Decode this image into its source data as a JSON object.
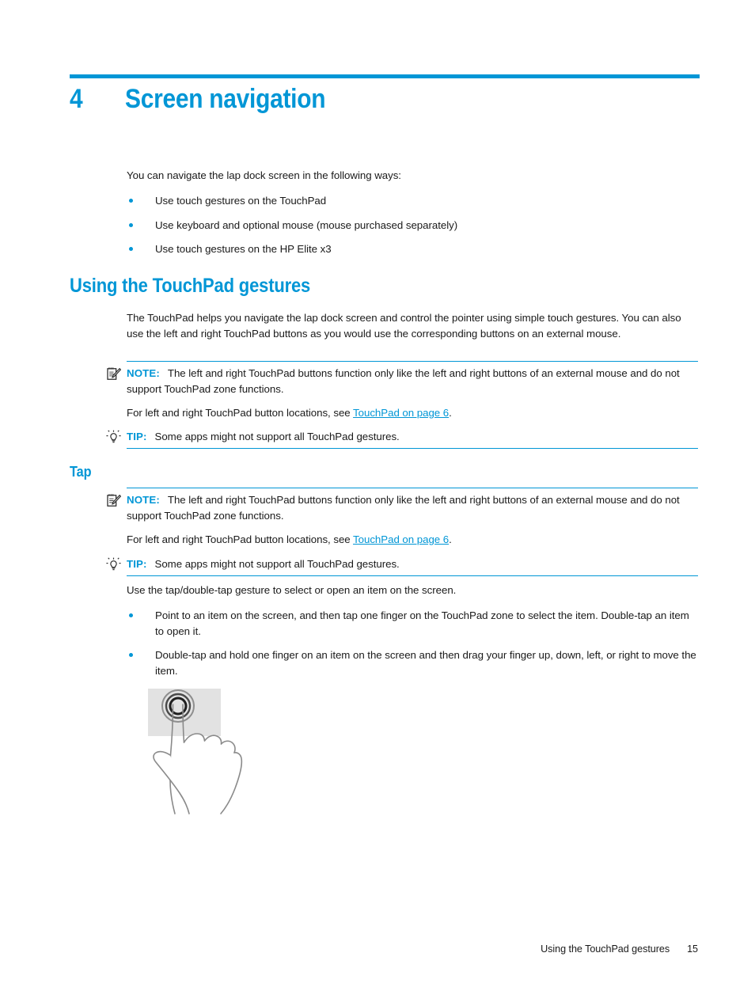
{
  "colors": {
    "accent": "#0096d6",
    "text": "#1a1a1a",
    "pad_fill": "#e2e2e2"
  },
  "chapter": {
    "number": "4",
    "title": "Screen navigation"
  },
  "intro": {
    "lead": "You can navigate the lap dock screen in the following ways:",
    "bullets": [
      "Use touch gestures on the TouchPad",
      "Use keyboard and optional mouse (mouse purchased separately)",
      "Use touch gestures on the HP Elite x3"
    ]
  },
  "section_touchpad": {
    "heading": "Using the TouchPad gestures",
    "para": "The TouchPad helps you navigate the lap dock screen and control the pointer using simple touch gestures. You can also use the left and right TouchPad buttons as you would use the corresponding buttons on an external mouse.",
    "note": {
      "label": "NOTE:",
      "icon": "note-pencil-icon",
      "text": "The left and right TouchPad buttons function only like the left and right buttons of an external mouse and do not support TouchPad zone functions."
    },
    "reference": {
      "before": "For left and right TouchPad button locations, see ",
      "link": "TouchPad on page 6",
      "after": "."
    },
    "tip": {
      "label": "TIP:",
      "icon": "lightbulb-icon",
      "text": "Some apps might not support all TouchPad gestures."
    }
  },
  "section_tap": {
    "heading": "Tap",
    "note": {
      "label": "NOTE:",
      "icon": "note-pencil-icon",
      "text": "The left and right TouchPad buttons function only like the left and right buttons of an external mouse and do not support TouchPad zone functions."
    },
    "reference": {
      "before": "For left and right TouchPad button locations, see ",
      "link": "TouchPad on page 6",
      "after": "."
    },
    "tip": {
      "label": "TIP:",
      "icon": "lightbulb-icon",
      "text": "Some apps might not support all TouchPad gestures."
    },
    "para": "Use the tap/double-tap gesture to select or open an item on the screen.",
    "bullets": [
      "Point to an item on the screen, and then tap one finger on the TouchPad zone to select the item. Double-tap an item to open it.",
      "Double-tap and hold one finger on an item on the screen and then drag your finger up, down, left, or right to move the item."
    ],
    "figure_alt": "tap-gesture-illustration"
  },
  "footer": {
    "section": "Using the TouchPad gestures",
    "page": "15"
  }
}
